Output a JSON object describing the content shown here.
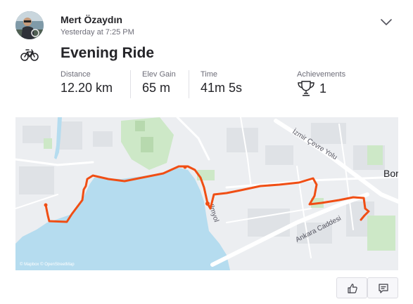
{
  "athlete": {
    "name": "Mert Özaydın",
    "timestamp": "Yesterday at 7:25 PM"
  },
  "activity": {
    "sport_icon": "bike-icon",
    "title": "Evening Ride"
  },
  "stats": {
    "distance_label": "Distance",
    "distance_value": "12.20 km",
    "elev_label": "Elev Gain",
    "elev_value": "65 m",
    "time_label": "Time",
    "time_value": "41m 5s",
    "achievements_label": "Achievements",
    "achievements_value": "1",
    "achievements_icon": "trophy-icon"
  },
  "map": {
    "route_color": "#f04e14",
    "water_color": "#b5dcef",
    "labels": {
      "road_1": "İzmir Çevre Yolu",
      "road_2": "Ankara Caddesi",
      "road_3": "Ilmyol",
      "place": "Bor"
    },
    "attribution": "© Mapbox © OpenStreetMap"
  },
  "actions": {
    "kudos_icon": "thumbs-up-icon",
    "comment_icon": "comment-icon"
  },
  "header": {
    "menu_icon": "chevron-down-icon"
  }
}
